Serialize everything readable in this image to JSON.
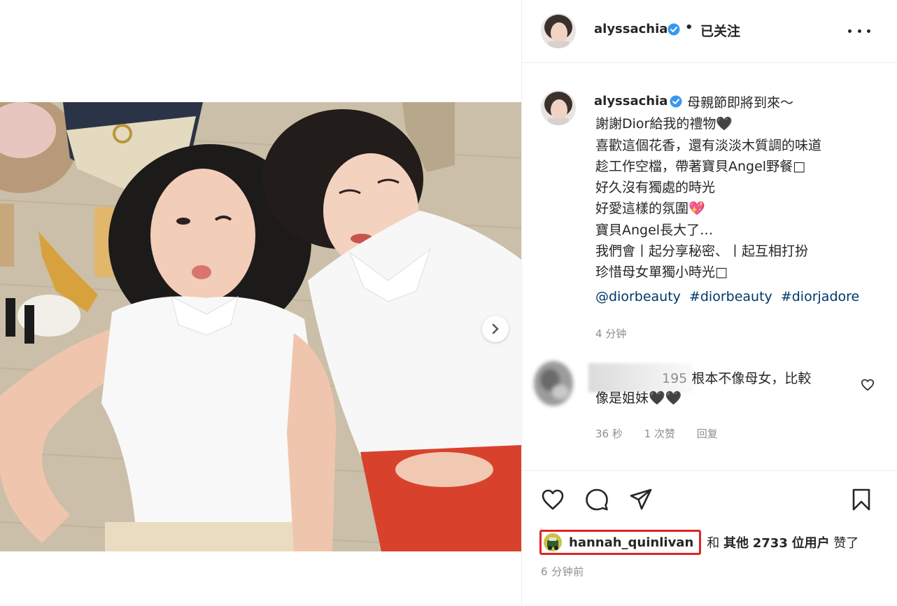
{
  "header": {
    "username": "alyssachia",
    "separator": "•",
    "follow_status": "已关注"
  },
  "caption": {
    "username": "alyssachia",
    "lines": [
      "母親節即將到來～",
      "謝謝Dior給我的禮物🖤",
      "喜歡這個花香，還有淡淡木質調的味道",
      "趁工作空檔，帶著寶貝Angel野餐□",
      "好久沒有獨處的時光",
      "好愛這樣的氛圍💖",
      "寶貝Angel長大了…",
      "我們會丨起分享秘密、丨起互相打扮",
      "珍惜母女單獨小時光□"
    ],
    "tags": [
      "@diorbeauty",
      "#diorbeauty",
      "#diorjadore"
    ],
    "age": "4 分钟"
  },
  "comment": {
    "handle_suffix": "195",
    "text_line1": "根本不像母女，比較",
    "text_line2": "像是姐妹🖤🖤",
    "time": "36 秒",
    "likes": "1 次赞",
    "reply": "回复"
  },
  "likes": {
    "liker": "hannah_quinlivan",
    "connector": "和",
    "others": "其他",
    "count": "2733",
    "unit": "位用户",
    "suffix": "赞了"
  },
  "post_time": "6 分钟前",
  "icons": {
    "like": "heart-icon",
    "comment": "comment-icon",
    "share": "share-icon",
    "save": "bookmark-icon",
    "verified": "verified-badge-icon",
    "more": "more-options-icon",
    "next": "chevron-right-icon"
  },
  "colors": {
    "verified_blue": "#3897f0",
    "link_blue": "#00376b",
    "highlight_red": "#e02424",
    "muted_text": "#8e8e8e"
  }
}
